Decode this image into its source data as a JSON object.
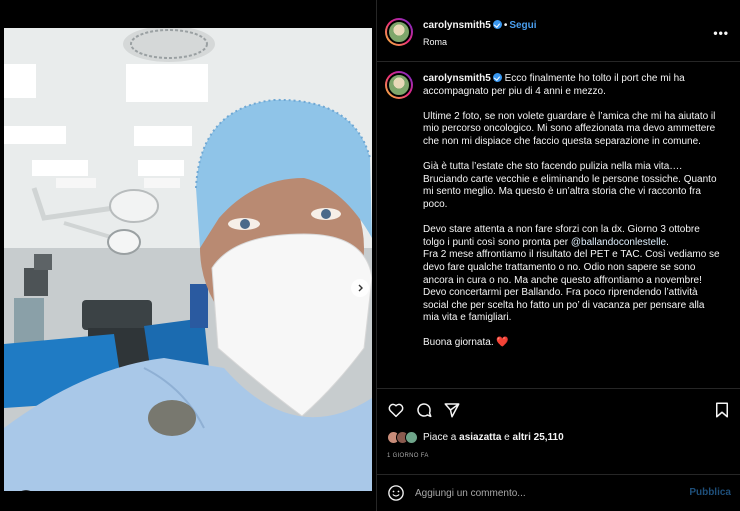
{
  "post": {
    "username": "carolynsmith5",
    "separator": "•",
    "follow_label": "Segui",
    "location": "Roma",
    "more_label": "•••"
  },
  "caption": {
    "username": "carolynsmith5",
    "paragraphs": [
      "Ecco finalmente ho tolto il port che mi ha accompagnato per piu di 4 anni e mezzo.",
      "Ultime 2 foto, se non volete guardare è l’amica che mi ha aiutato il mio percorso oncologico. Mi sono affezionata ma devo ammettere che non mi dispiace che faccio questa separazione in comune.",
      "Già è tutta l’estate che sto facendo pulizia nella mia vita…. Bruciando carte vecchie e eliminando le persone tossiche. Quanto mi sento meglio. Ma questo è un’altra storia che vi racconto fra poco."
    ],
    "p4_before": "Devo stare attenta a non fare sforzi con la dx. Giorno 3 ottobre tolgo i punti così sono pronta per ",
    "p4_mention": "@ballandoconlestelle",
    "p4_after": ".",
    "p4_lines": [
      "Fra 2 mese affrontiamo il risultato del PET e TAC. Così vediamo se devo fare qualche trattamento o no. Odio non sapere se sono ancora in cura o no. Ma anche questo affrontiamo a novembre!",
      "Devo concertarmi per Ballando. Fra poco riprendendo l’attività social che per scelta ho fatto un po’ di vacanza per pensare alla mia vita e famigliari."
    ],
    "closing": "Buona giornata. ❤️"
  },
  "likes": {
    "prefix": "Piace a",
    "user": "asiazatta",
    "middle": "e",
    "others": "altri 25,110"
  },
  "time_ago": "1 GIORNO FA",
  "comment": {
    "placeholder": "Aggiungi un commento...",
    "publish_label": "Pubblica"
  },
  "carousel": {
    "total": 4,
    "active_index": 0
  },
  "colors": {
    "background": "#000000",
    "accent_blue": "#4a9eed",
    "verified_blue": "#3897f0",
    "muted_text": "#a8a8a8",
    "divider": "#262626"
  },
  "icons": [
    "heart-icon",
    "comment-icon",
    "share-icon",
    "bookmark-icon",
    "emoji-icon",
    "chevron-right-icon",
    "user-tag-icon",
    "verified-badge-icon"
  ]
}
